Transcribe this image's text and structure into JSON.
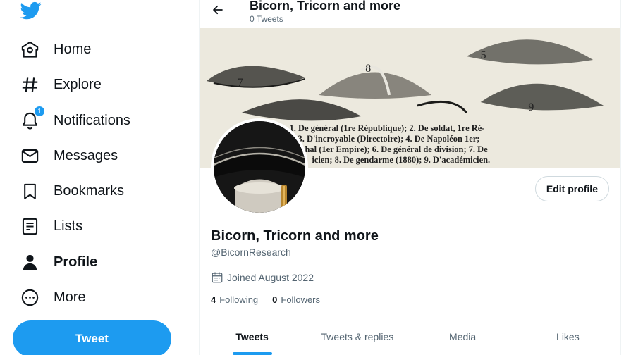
{
  "brand": {
    "accent": "#1d9bf0",
    "logo_icon": "twitter-bird-icon"
  },
  "nav": {
    "items": [
      {
        "label": "Home",
        "icon": "home-icon"
      },
      {
        "label": "Explore",
        "icon": "hashtag-icon"
      },
      {
        "label": "Notifications",
        "icon": "bell-icon",
        "badge": "1"
      },
      {
        "label": "Messages",
        "icon": "envelope-icon"
      },
      {
        "label": "Bookmarks",
        "icon": "bookmark-icon"
      },
      {
        "label": "Lists",
        "icon": "list-icon"
      },
      {
        "label": "Profile",
        "icon": "person-icon",
        "active": true
      },
      {
        "label": "More",
        "icon": "more-circle-icon"
      }
    ],
    "tweet_button": "Tweet"
  },
  "header": {
    "title": "Bicorn, Tricorn and more",
    "tweet_count": "0 Tweets"
  },
  "banner": {
    "caption_lines": [
      "1. De général (1re République); 2. De soldat, 1re Ré-",
      "3. D'incroyable (Directoire); 4. De Napoléon 1er;",
      "hal (1er Empire); 6. De général de division; 7. De",
      "icien; 8. De gendarme (1880); 9. D'académicien."
    ],
    "numbers": [
      "5",
      "8",
      "7",
      "9"
    ]
  },
  "profile": {
    "display_name": "Bicorn, Tricorn and more",
    "handle": "@BicornResearch",
    "joined": "Joined August 2022",
    "following_count": "4",
    "following_label": "Following",
    "followers_count": "0",
    "followers_label": "Followers",
    "edit_button": "Edit profile"
  },
  "tabs": [
    {
      "label": "Tweets",
      "active": true
    },
    {
      "label": "Tweets & replies"
    },
    {
      "label": "Media"
    },
    {
      "label": "Likes"
    }
  ]
}
